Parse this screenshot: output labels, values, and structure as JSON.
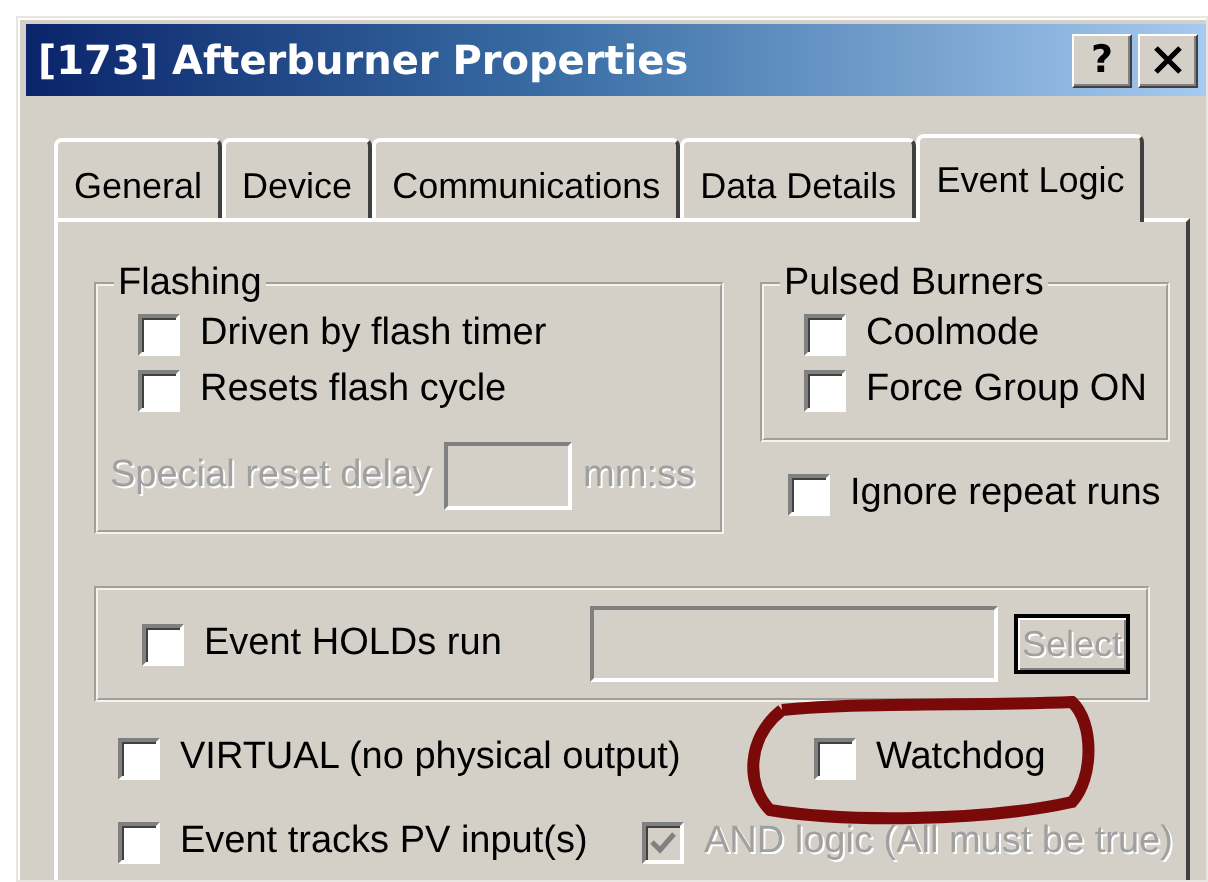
{
  "window": {
    "title": "[173] Afterburner Properties",
    "help_button": "?"
  },
  "tabs": [
    {
      "label": "General",
      "selected": false
    },
    {
      "label": "Device",
      "selected": false
    },
    {
      "label": "Communications",
      "selected": false
    },
    {
      "label": "Data Details",
      "selected": false
    },
    {
      "label": "Event Logic",
      "selected": true
    }
  ],
  "flashing": {
    "title": "Flashing",
    "options": [
      {
        "label": "Driven by flash timer",
        "checked": false
      },
      {
        "label": "Resets flash cycle",
        "checked": false
      }
    ],
    "delay": {
      "label": "Special reset delay",
      "unit": "mm:ss",
      "disabled": true
    }
  },
  "pulsed_burners": {
    "title": "Pulsed Burners",
    "options": [
      {
        "label": "Coolmode",
        "checked": false
      },
      {
        "label": "Force Group ON",
        "checked": false
      }
    ]
  },
  "ignore_repeat_runs": {
    "label": "Ignore repeat runs",
    "checked": false
  },
  "event_holds": {
    "label": "Event HOLDs run",
    "checked": false,
    "button": "Select",
    "button_disabled": true
  },
  "options": [
    {
      "label": "VIRTUAL (no physical output)",
      "checked": false,
      "disabled": false,
      "circled": false
    },
    {
      "label": "Watchdog",
      "checked": false,
      "disabled": false,
      "circled": true
    },
    {
      "label": "Event tracks PV input(s)",
      "checked": false,
      "disabled": false,
      "circled": false
    },
    {
      "label": "AND logic (All must be true)",
      "checked": true,
      "disabled": true,
      "circled": false
    }
  ]
}
